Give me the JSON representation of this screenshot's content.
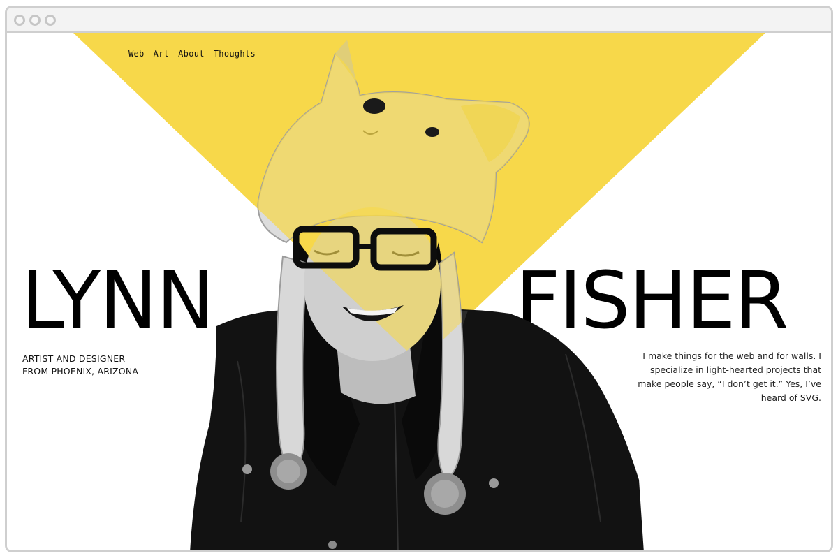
{
  "nav": {
    "items": [
      "Web",
      "Art",
      "About",
      "Thoughts"
    ]
  },
  "hero": {
    "first_name": "LYNN",
    "last_name": "FISHER",
    "tagline_line1": "ARTIST AND DESIGNER",
    "tagline_line2": "FROM PHOENIX, ARIZONA",
    "bio": "I make things for the web and for walls. I specialize in light-hearted projects that make people say, “I don’t get it.” Yes, I’ve heard of SVG."
  },
  "colors": {
    "accent": "#f7d84a",
    "text": "#000000",
    "window_border": "#cfcfcf",
    "titlebar": "#f3f3f3"
  },
  "icons": {
    "window_controls": [
      "window-dot-icon",
      "window-dot-icon",
      "window-dot-icon"
    ]
  }
}
